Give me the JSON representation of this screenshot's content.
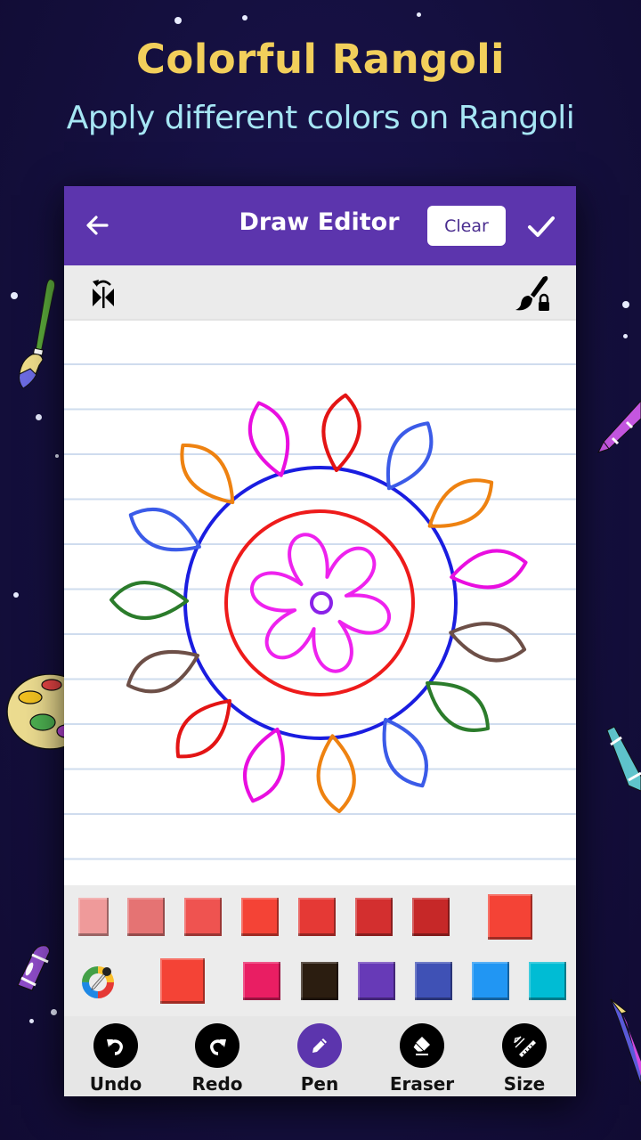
{
  "promo": {
    "headline": "Colorful Rangoli",
    "subheadline": "Apply different colors on Rangoli",
    "headline_color": "#f2cf5b",
    "subheadline_color": "#a6e6f4",
    "background_color": "#15103f"
  },
  "appbar": {
    "title": "Draw Editor",
    "back_icon": "arrow-left-icon",
    "clear_label": "Clear",
    "done_icon": "checkmark-icon",
    "color": "#5c35ad"
  },
  "toolstrip": {
    "left_icon": "mirror-flip-icon",
    "right_icon": "brush-lock-icon"
  },
  "canvas": {
    "drawing": "rangoli",
    "stroke_colors": {
      "outer_ring": "#1a1de0",
      "inner_ring": "#ee1b1b",
      "flower": "#ee22ee",
      "center_dot": "#8a22e8"
    },
    "petals": [
      {
        "color": "#e90ee0"
      },
      {
        "color": "#e31414"
      },
      {
        "color": "#3b5be8"
      },
      {
        "color": "#ee8211"
      },
      {
        "color": "#e90ee0"
      },
      {
        "color": "#6d4f47"
      },
      {
        "color": "#2b7c2b"
      },
      {
        "color": "#3b5be8"
      },
      {
        "color": "#ee8211"
      },
      {
        "color": "#e90ee0"
      },
      {
        "color": "#e31414"
      },
      {
        "color": "#6d4f47"
      },
      {
        "color": "#2b7c2b"
      },
      {
        "color": "#3b5be8"
      },
      {
        "color": "#ee8211"
      }
    ]
  },
  "palette": {
    "shades": [
      "#ef9a9a",
      "#e57373",
      "#ef5350",
      "#f44336",
      "#e53935",
      "#d32f2f",
      "#c62828"
    ],
    "selected_shade": "#f44336",
    "current_color": "#f44336",
    "color_picker_icon": "color-picker-icon",
    "base_colors": [
      "#e91e63",
      "#2b1d10",
      "#673ab7",
      "#3f51b5",
      "#2196f3",
      "#00bcd4"
    ]
  },
  "tools": [
    {
      "label": "Undo",
      "icon": "undo-icon",
      "active": false
    },
    {
      "label": "Redo",
      "icon": "redo-icon",
      "active": false
    },
    {
      "label": "Pen",
      "icon": "pen-icon",
      "active": true
    },
    {
      "label": "Eraser",
      "icon": "eraser-icon",
      "active": false
    },
    {
      "label": "Size",
      "icon": "ruler-size-icon",
      "active": false
    }
  ]
}
